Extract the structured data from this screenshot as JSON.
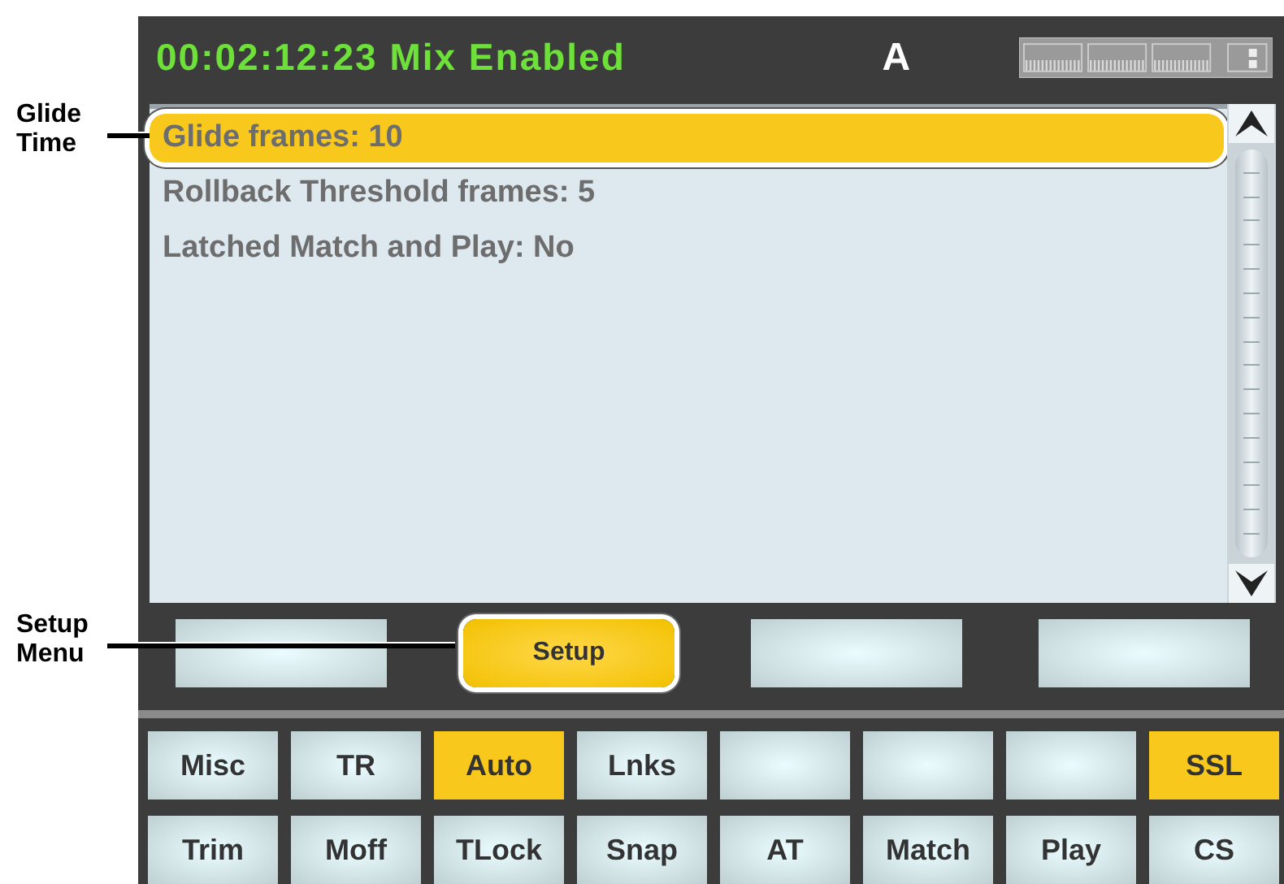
{
  "annotations": [
    {
      "label": "Glide Time"
    },
    {
      "label": "Setup Menu"
    }
  ],
  "header": {
    "status": "00:02:12:23 Mix Enabled",
    "mode": "A"
  },
  "list": [
    {
      "label": "Glide frames: 10",
      "selected": true
    },
    {
      "label": "Rollback Threshold frames: 5",
      "selected": false
    },
    {
      "label": "Latched Match and Play: No",
      "selected": false
    }
  ],
  "softkeys": [
    {
      "selected": false
    },
    {
      "label": "Setup",
      "selected": true
    },
    {
      "selected": false
    },
    {
      "selected": false
    }
  ],
  "buttons": [
    {
      "label": "Misc",
      "on": false
    },
    {
      "label": "TR",
      "on": false
    },
    {
      "label": "Auto",
      "on": true
    },
    {
      "label": "Lnks",
      "on": false
    },
    {
      "on": false
    },
    {
      "on": false
    },
    {
      "on": false
    },
    {
      "label": "SSL",
      "on": true
    },
    {
      "label": "Trim",
      "on": false
    },
    {
      "label": "Moff",
      "on": false
    },
    {
      "label": "TLock",
      "on": false
    },
    {
      "label": "Snap",
      "on": false
    },
    {
      "label": "AT",
      "on": false
    },
    {
      "label": "Match",
      "on": false
    },
    {
      "label": "Play",
      "on": false
    },
    {
      "label": "CS",
      "on": false
    }
  ]
}
